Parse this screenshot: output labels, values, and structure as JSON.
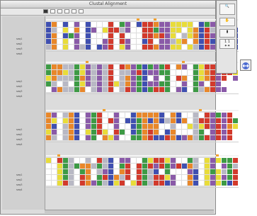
{
  "window": {
    "title": "Clustal Alignment"
  },
  "toolbar": {
    "buttons": [
      "menu",
      "back",
      "select",
      "zoom",
      "color",
      "save"
    ]
  },
  "tool_palette": {
    "tools": [
      "zoom-in-icon",
      "hand-icon",
      "column-select-icon",
      "arrows-icon"
    ],
    "value_readout": "1 1"
  },
  "side_button": {
    "icon": "shift-arrows-icon"
  },
  "blocks": [
    {
      "names": [
        "seq1",
        "seq2",
        "seq3",
        "seq4"
      ]
    },
    {
      "names": [
        "seq1",
        "seq2",
        "seq3",
        "seq4"
      ]
    },
    {
      "names": [
        "seq1",
        "seq2",
        "seq3",
        "seq4"
      ]
    },
    {
      "names": [
        "seq1",
        "seq2",
        "seq3",
        "seq4"
      ]
    }
  ],
  "colors": {
    "red": "#d23a2c",
    "blue": "#3f4fb0",
    "purple": "#8a5aa8",
    "orange": "#e8872a",
    "green": "#3d9a45",
    "yellow": "#e8dc3a",
    "gray": "#b8b8c4",
    "marker": "#f0a030"
  }
}
